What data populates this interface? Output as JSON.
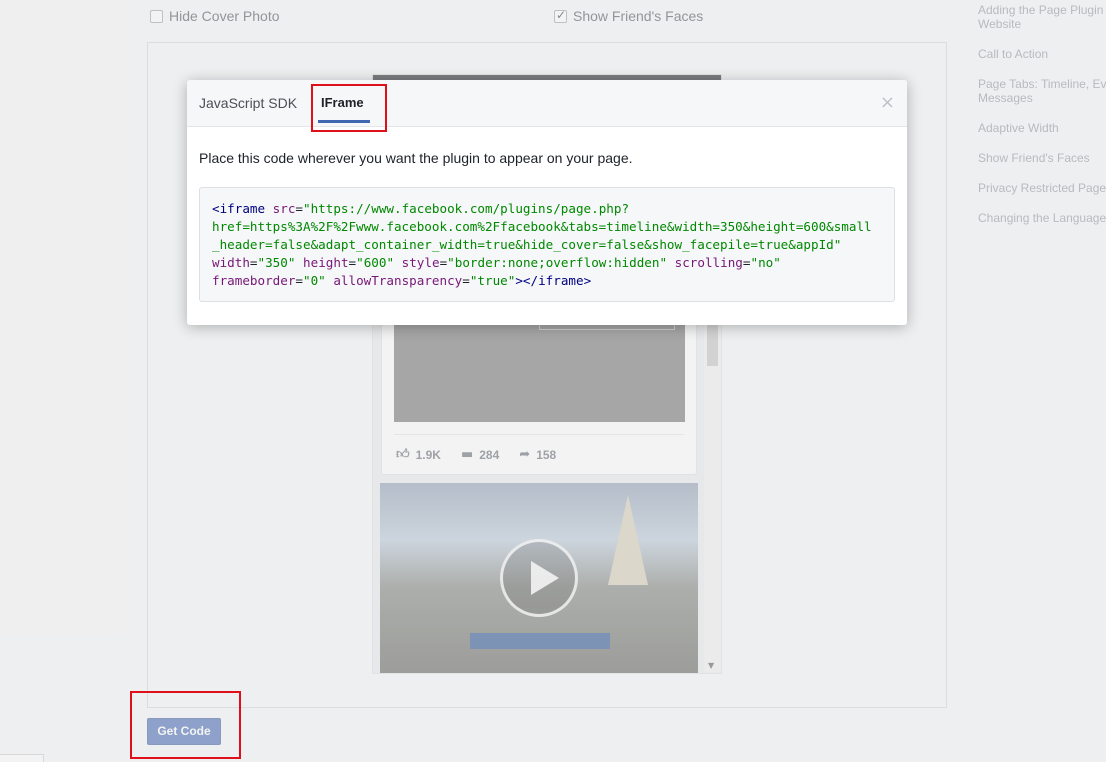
{
  "options": {
    "hide_cover": {
      "label": "Hide Cover Photo",
      "checked": false
    },
    "show_faces": {
      "label": "Show Friend's Faces",
      "checked": true
    }
  },
  "sidebar": {
    "items": [
      "Adding the Page Plugin",
      "Website",
      "Call to Action",
      "Page Tabs: Timeline, Events,",
      "Messages",
      "Adaptive Width",
      "Show Friend's Faces",
      "Privacy Restricted Pages",
      "Changing the Language"
    ]
  },
  "preview": {
    "stats": {
      "likes": "1.9K",
      "comments": "284",
      "shares": "158"
    },
    "icons": {
      "like": "thumbs-up-icon",
      "comment": "comment-icon",
      "share": "share-icon",
      "play": "play-icon"
    }
  },
  "get_code_label": "Get Code",
  "modal": {
    "tabs": [
      {
        "label": "JavaScript SDK",
        "active": false
      },
      {
        "label": "IFrame",
        "active": true
      }
    ],
    "close_glyph": "×",
    "instruction": "Place this code wherever you want the plugin to appear on your page.",
    "code": {
      "l1_tag_open": "<iframe",
      "l1_attr": "src",
      "l1_eq": "=",
      "l1_str": "\"https://www.facebook.com/plugins/page.php?",
      "l2": "href=https%3A%2F%2Fwww.facebook.com%2Ffacebook&tabs=timeline&width=350&height=600&small",
      "l3": "_header=false&adapt_container_width=true&hide_cover=false&show_facepile=true&appId\"",
      "l4_a1": "width",
      "l4_v1": "\"350\"",
      "l4_a2": "height",
      "l4_v2": "\"600\"",
      "l4_a3": "style",
      "l4_v3": "\"border:none;overflow:hidden\"",
      "l4_a4": "scrolling",
      "l4_v4": "\"no\"",
      "l5_a1": "frameborder",
      "l5_v1": "\"0\"",
      "l5_a2": "allowTransparency",
      "l5_v2": "\"true\"",
      "l5_close": "></iframe>"
    }
  },
  "colors": {
    "accent": "#4267b2",
    "highlight": "#e0101b"
  }
}
